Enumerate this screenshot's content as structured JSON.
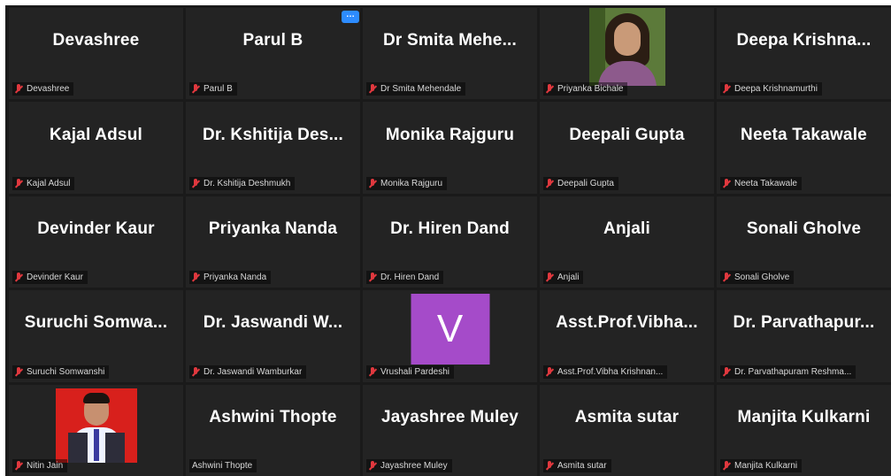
{
  "menu_button": {
    "icon": "more-icon",
    "glyph": "…"
  },
  "colors": {
    "mic_muted": "#e0383e",
    "menu_accent": "#2d8cff",
    "avatar_bg": "#a54bc9"
  },
  "tiles": [
    {
      "display": "Devashree",
      "label": "Devashree"
    },
    {
      "display": "Parul B",
      "label": "Parul B"
    },
    {
      "display": "Dr Smita Mehe...",
      "label": "Dr Smita Mehendale"
    },
    {
      "display": "",
      "label": "Priyanka Bichale"
    },
    {
      "display": "Deepa Krishna...",
      "label": "Deepa Krishnamurthi"
    },
    {
      "display": "Kajal Adsul",
      "label": "Kajal Adsul"
    },
    {
      "display": "Dr. Kshitija Des...",
      "label": "Dr. Kshitija Deshmukh"
    },
    {
      "display": "Monika Rajguru",
      "label": "Monika Rajguru"
    },
    {
      "display": "Deepali Gupta",
      "label": "Deepali Gupta"
    },
    {
      "display": "Neeta Takawale",
      "label": "Neeta Takawale"
    },
    {
      "display": "Devinder Kaur",
      "label": "Devinder Kaur"
    },
    {
      "display": "Priyanka Nanda",
      "label": "Priyanka Nanda"
    },
    {
      "display": "Dr. Hiren Dand",
      "label": "Dr. Hiren Dand"
    },
    {
      "display": "Anjali",
      "label": "Anjali"
    },
    {
      "display": "Sonali Gholve",
      "label": "Sonali Gholve"
    },
    {
      "display": "Suruchi Somwa...",
      "label": "Suruchi Somwanshi"
    },
    {
      "display": "Dr. Jaswandi W...",
      "label": "Dr. Jaswandi Wamburkar"
    },
    {
      "display": "",
      "avatar": "V",
      "label": "Vrushali Pardeshi"
    },
    {
      "display": "Asst.Prof.Vibha...",
      "label": "Asst.Prof.Vibha Krishnan..."
    },
    {
      "display": "Dr. Parvathapur...",
      "label": "Dr. Parvathapuram Reshma..."
    },
    {
      "display": "",
      "label": "Nitin Jain"
    },
    {
      "display": "Ashwini Thopte",
      "label": "Ashwini Thopte"
    },
    {
      "display": "Jayashree Muley",
      "label": "Jayashree Muley"
    },
    {
      "display": "Asmita sutar",
      "label": "Asmita sutar"
    },
    {
      "display": "Manjita Kulkarni",
      "label": "Manjita Kulkarni"
    }
  ]
}
